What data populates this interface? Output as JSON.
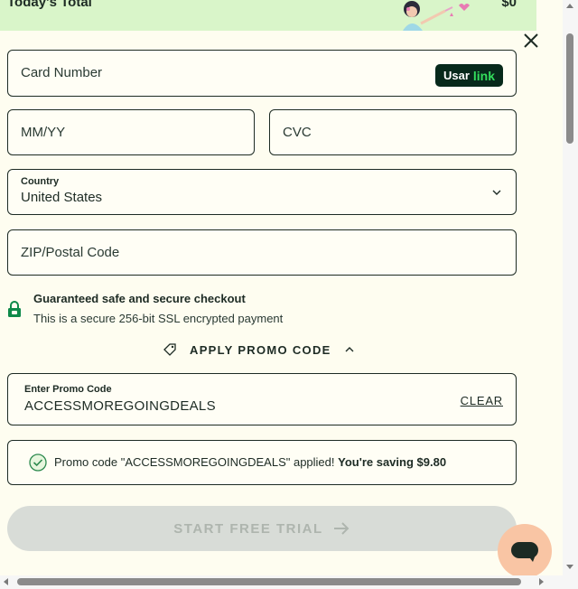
{
  "header": {
    "title": "Today's Total",
    "amount": "$0"
  },
  "form": {
    "card_number": {
      "placeholder": "Card Number"
    },
    "link_button": {
      "prefix": "Usar",
      "brand": "link"
    },
    "expiry": {
      "placeholder": "MM/YY"
    },
    "cvc": {
      "placeholder": "CVC"
    },
    "country": {
      "label": "Country",
      "value": "United States"
    },
    "zip": {
      "placeholder": "ZIP/Postal Code"
    }
  },
  "security": {
    "title": "Guaranteed safe and secure checkout",
    "subtitle": "This is a secure 256-bit SSL encrypted payment"
  },
  "promo": {
    "toggle_label": "APPLY PROMO CODE",
    "input_label": "Enter Promo Code",
    "code": "ACCESSMOREGOINGDEALS",
    "clear_label": "CLEAR",
    "applied_message": "Promo code \"ACCESSMOREGOINGDEALS\" applied!",
    "saving_message": "You're saving $9.80"
  },
  "cta": {
    "label": "START FREE TRIAL"
  },
  "colors": {
    "header_bg": "#d9f5c9",
    "page_bg": "#fefdf0",
    "text": "#1d2b24",
    "link_bg": "#07291b",
    "link_brand": "#33dd5c",
    "lock": "#0f8a4a",
    "cta_disabled_bg": "#d8dcd7",
    "chat_bg": "#f9c5a4"
  }
}
